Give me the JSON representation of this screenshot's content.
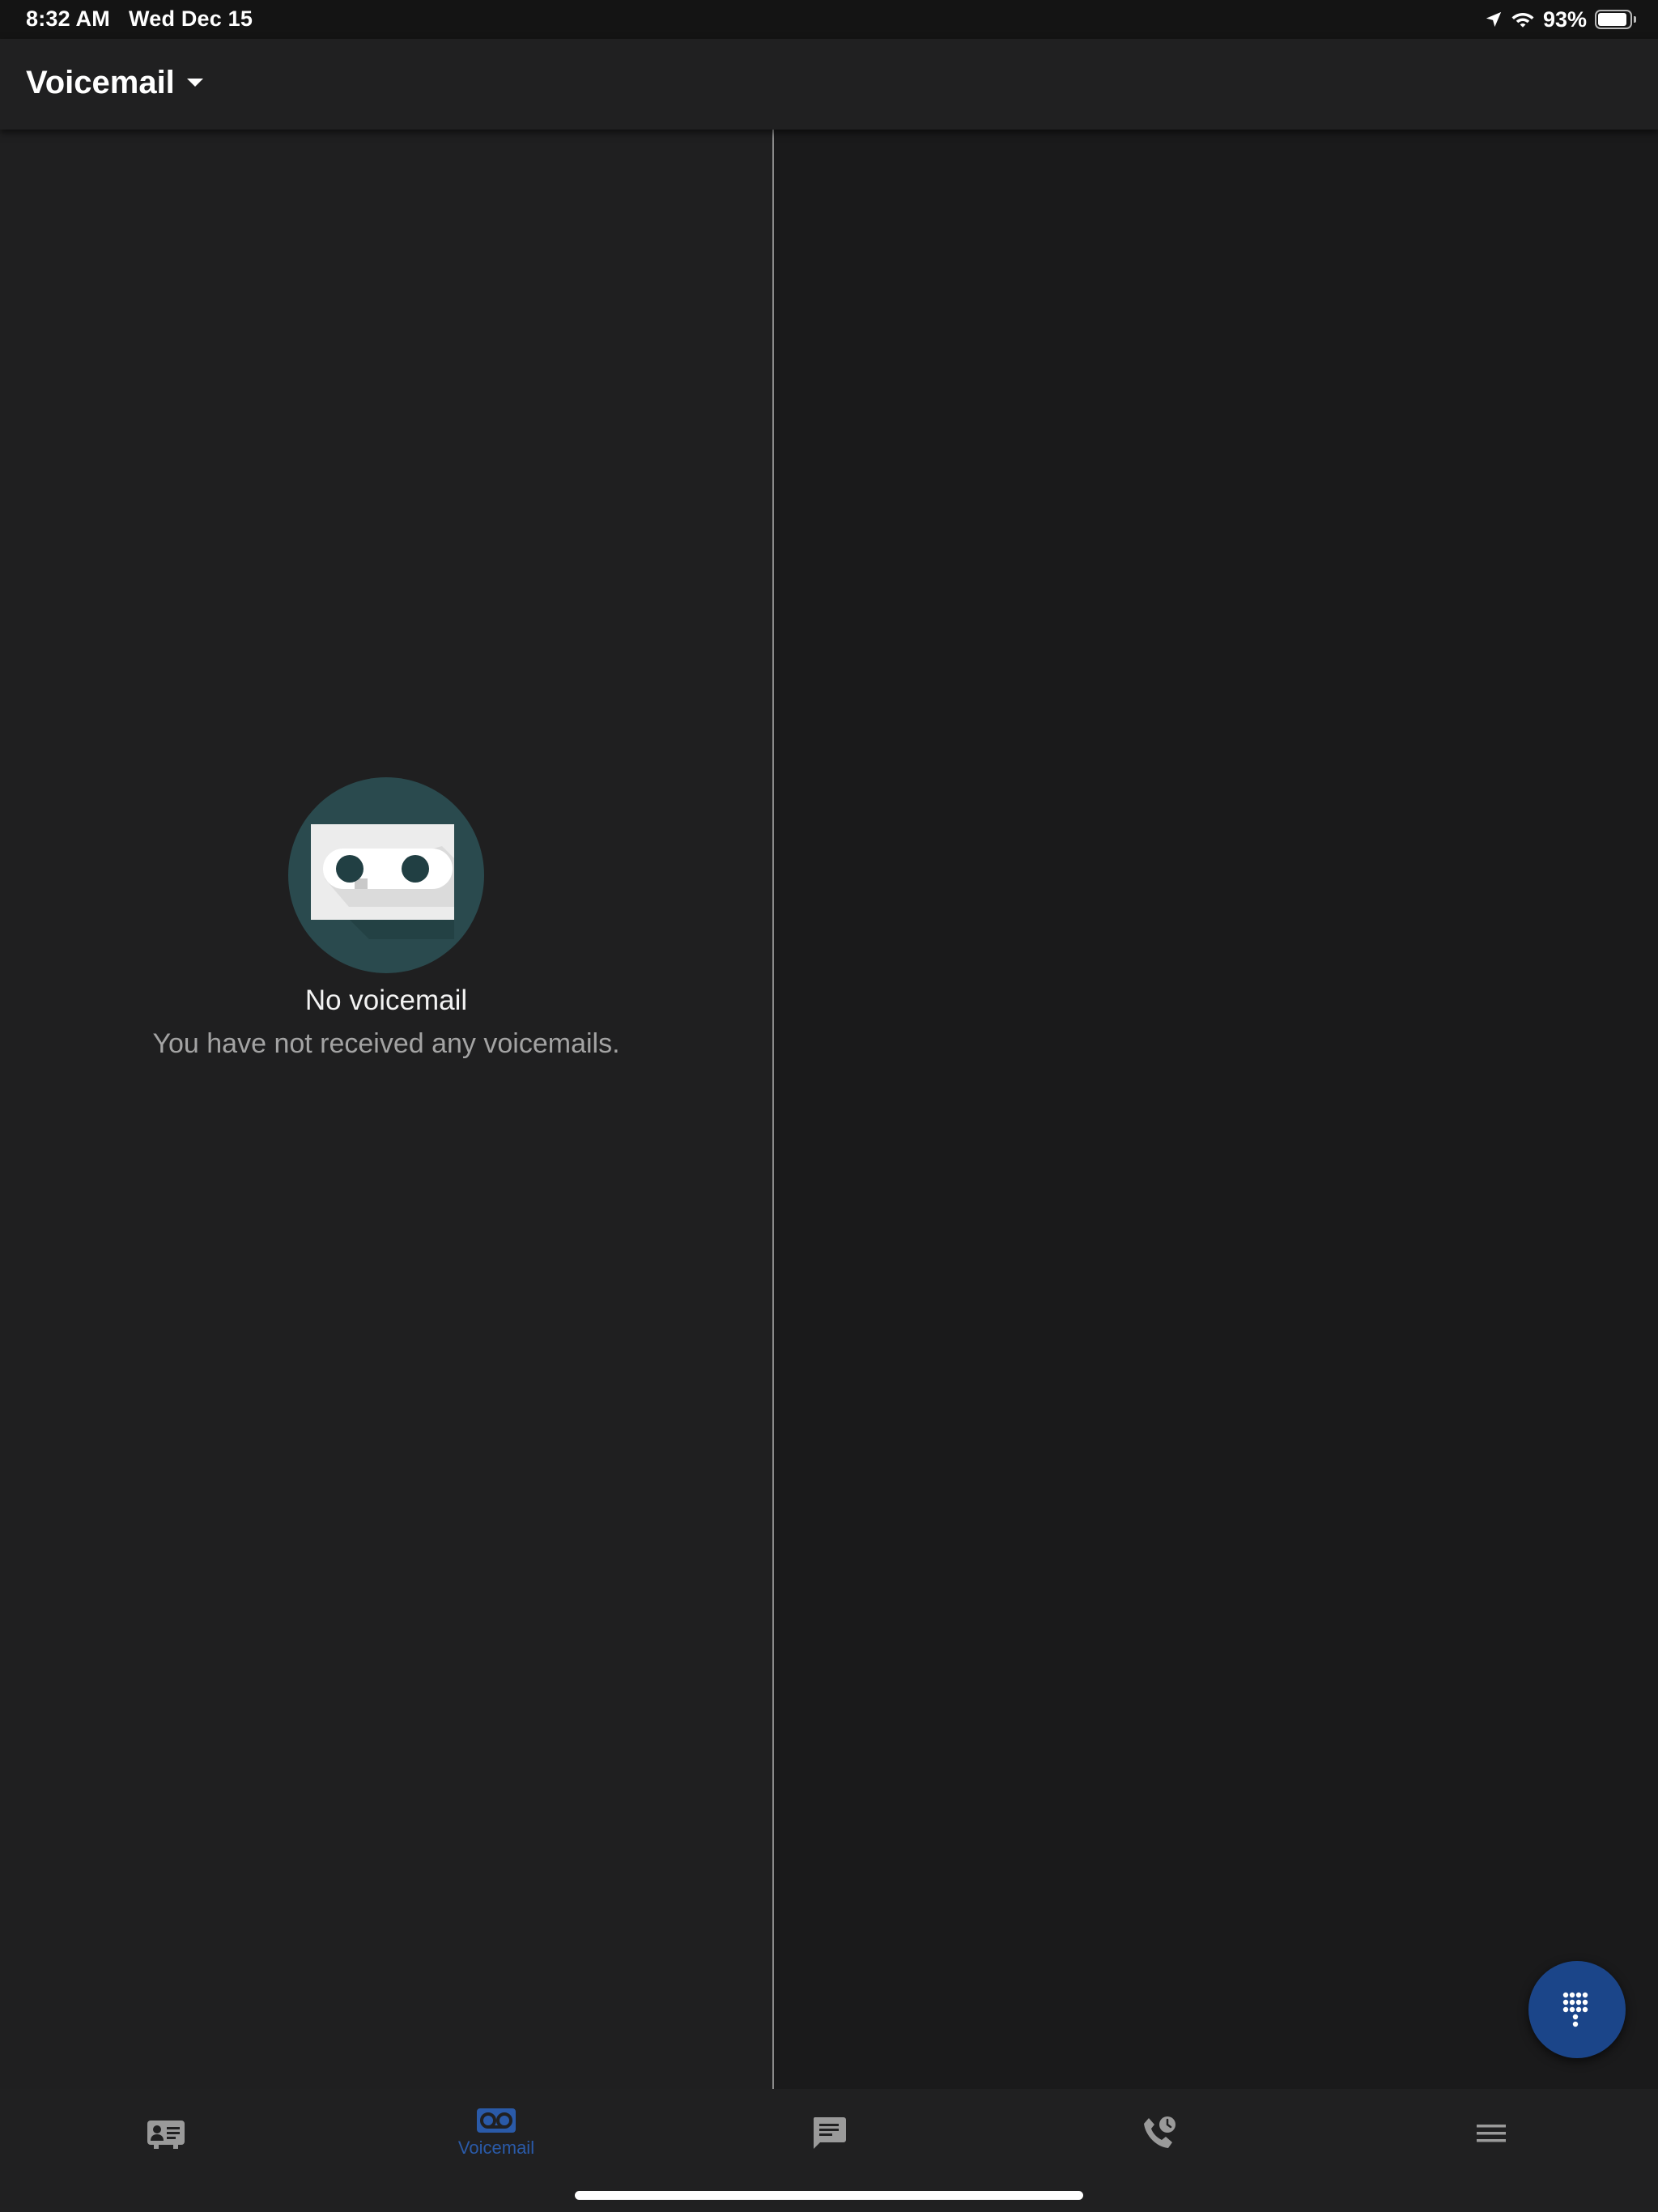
{
  "status_bar": {
    "time": "8:32 AM",
    "date": "Wed Dec 15",
    "battery_percent": "93%",
    "battery_level": 0.93,
    "icons": [
      "location-arrow-icon",
      "wifi-icon",
      "battery-icon"
    ]
  },
  "app_bar": {
    "title": "Voicemail",
    "dropdown_icon": "caret-down-icon"
  },
  "empty_state": {
    "icon": "voicemail-illustration",
    "title": "No voicemail",
    "subtitle": "You have not received any voicemails."
  },
  "fab": {
    "icon": "dialpad-icon"
  },
  "bottom_nav": {
    "items": [
      {
        "icon": "contacts-card-icon",
        "label": "",
        "active": false
      },
      {
        "icon": "voicemail-icon",
        "label": "Voicemail",
        "active": true
      },
      {
        "icon": "chat-icon",
        "label": "",
        "active": false
      },
      {
        "icon": "call-history-icon",
        "label": "",
        "active": false
      },
      {
        "icon": "menu-icon",
        "label": "",
        "active": false
      }
    ]
  },
  "colors": {
    "background": "#1c1c1d",
    "accent": "#1b4589",
    "active_nav": "#2a5aa8",
    "inactive_icon": "#9a9a9a",
    "illustration_circle": "#2a4a4e"
  }
}
